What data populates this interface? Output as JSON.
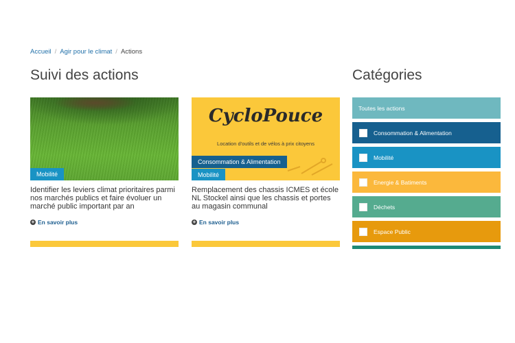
{
  "breadcrumb": [
    {
      "label": "Accueil"
    },
    {
      "label": "Agir pour le climat"
    },
    {
      "label": "Actions"
    }
  ],
  "main": {
    "title": "Suivi des actions",
    "cards": [
      {
        "tags": [
          "Mobilité"
        ],
        "text": "Identifier les leviers climat prioritaires parmi nos marchés publics et faire évoluer un marché public important par an",
        "more": "En savoir plus"
      },
      {
        "tags": [
          "Consommation & Alimentation",
          "Mobilité"
        ],
        "logo": "CycloPouce",
        "logo_sub": "Location d'outils et de vélos à prix citoyens",
        "text": "Remplacement des chassis ICMES et école NL Stockel ainsi que les chassis et portes au magasin communal",
        "more": "En savoir plus"
      }
    ]
  },
  "sidebar": {
    "title": "Catégories",
    "all_label": "Toutes les actions",
    "categories": [
      {
        "label": "Consommation & Alimentation",
        "color": "#16608f"
      },
      {
        "label": "Mobilité",
        "color": "#1993c4"
      },
      {
        "label": "Energie & Batiments",
        "color": "#fbb83c"
      },
      {
        "label": "Déchets",
        "color": "#55ab8f"
      },
      {
        "label": "Espace Public",
        "color": "#e79a0d"
      }
    ],
    "all_color": "#6fb8bf",
    "tail_color": "#1e8a76"
  }
}
